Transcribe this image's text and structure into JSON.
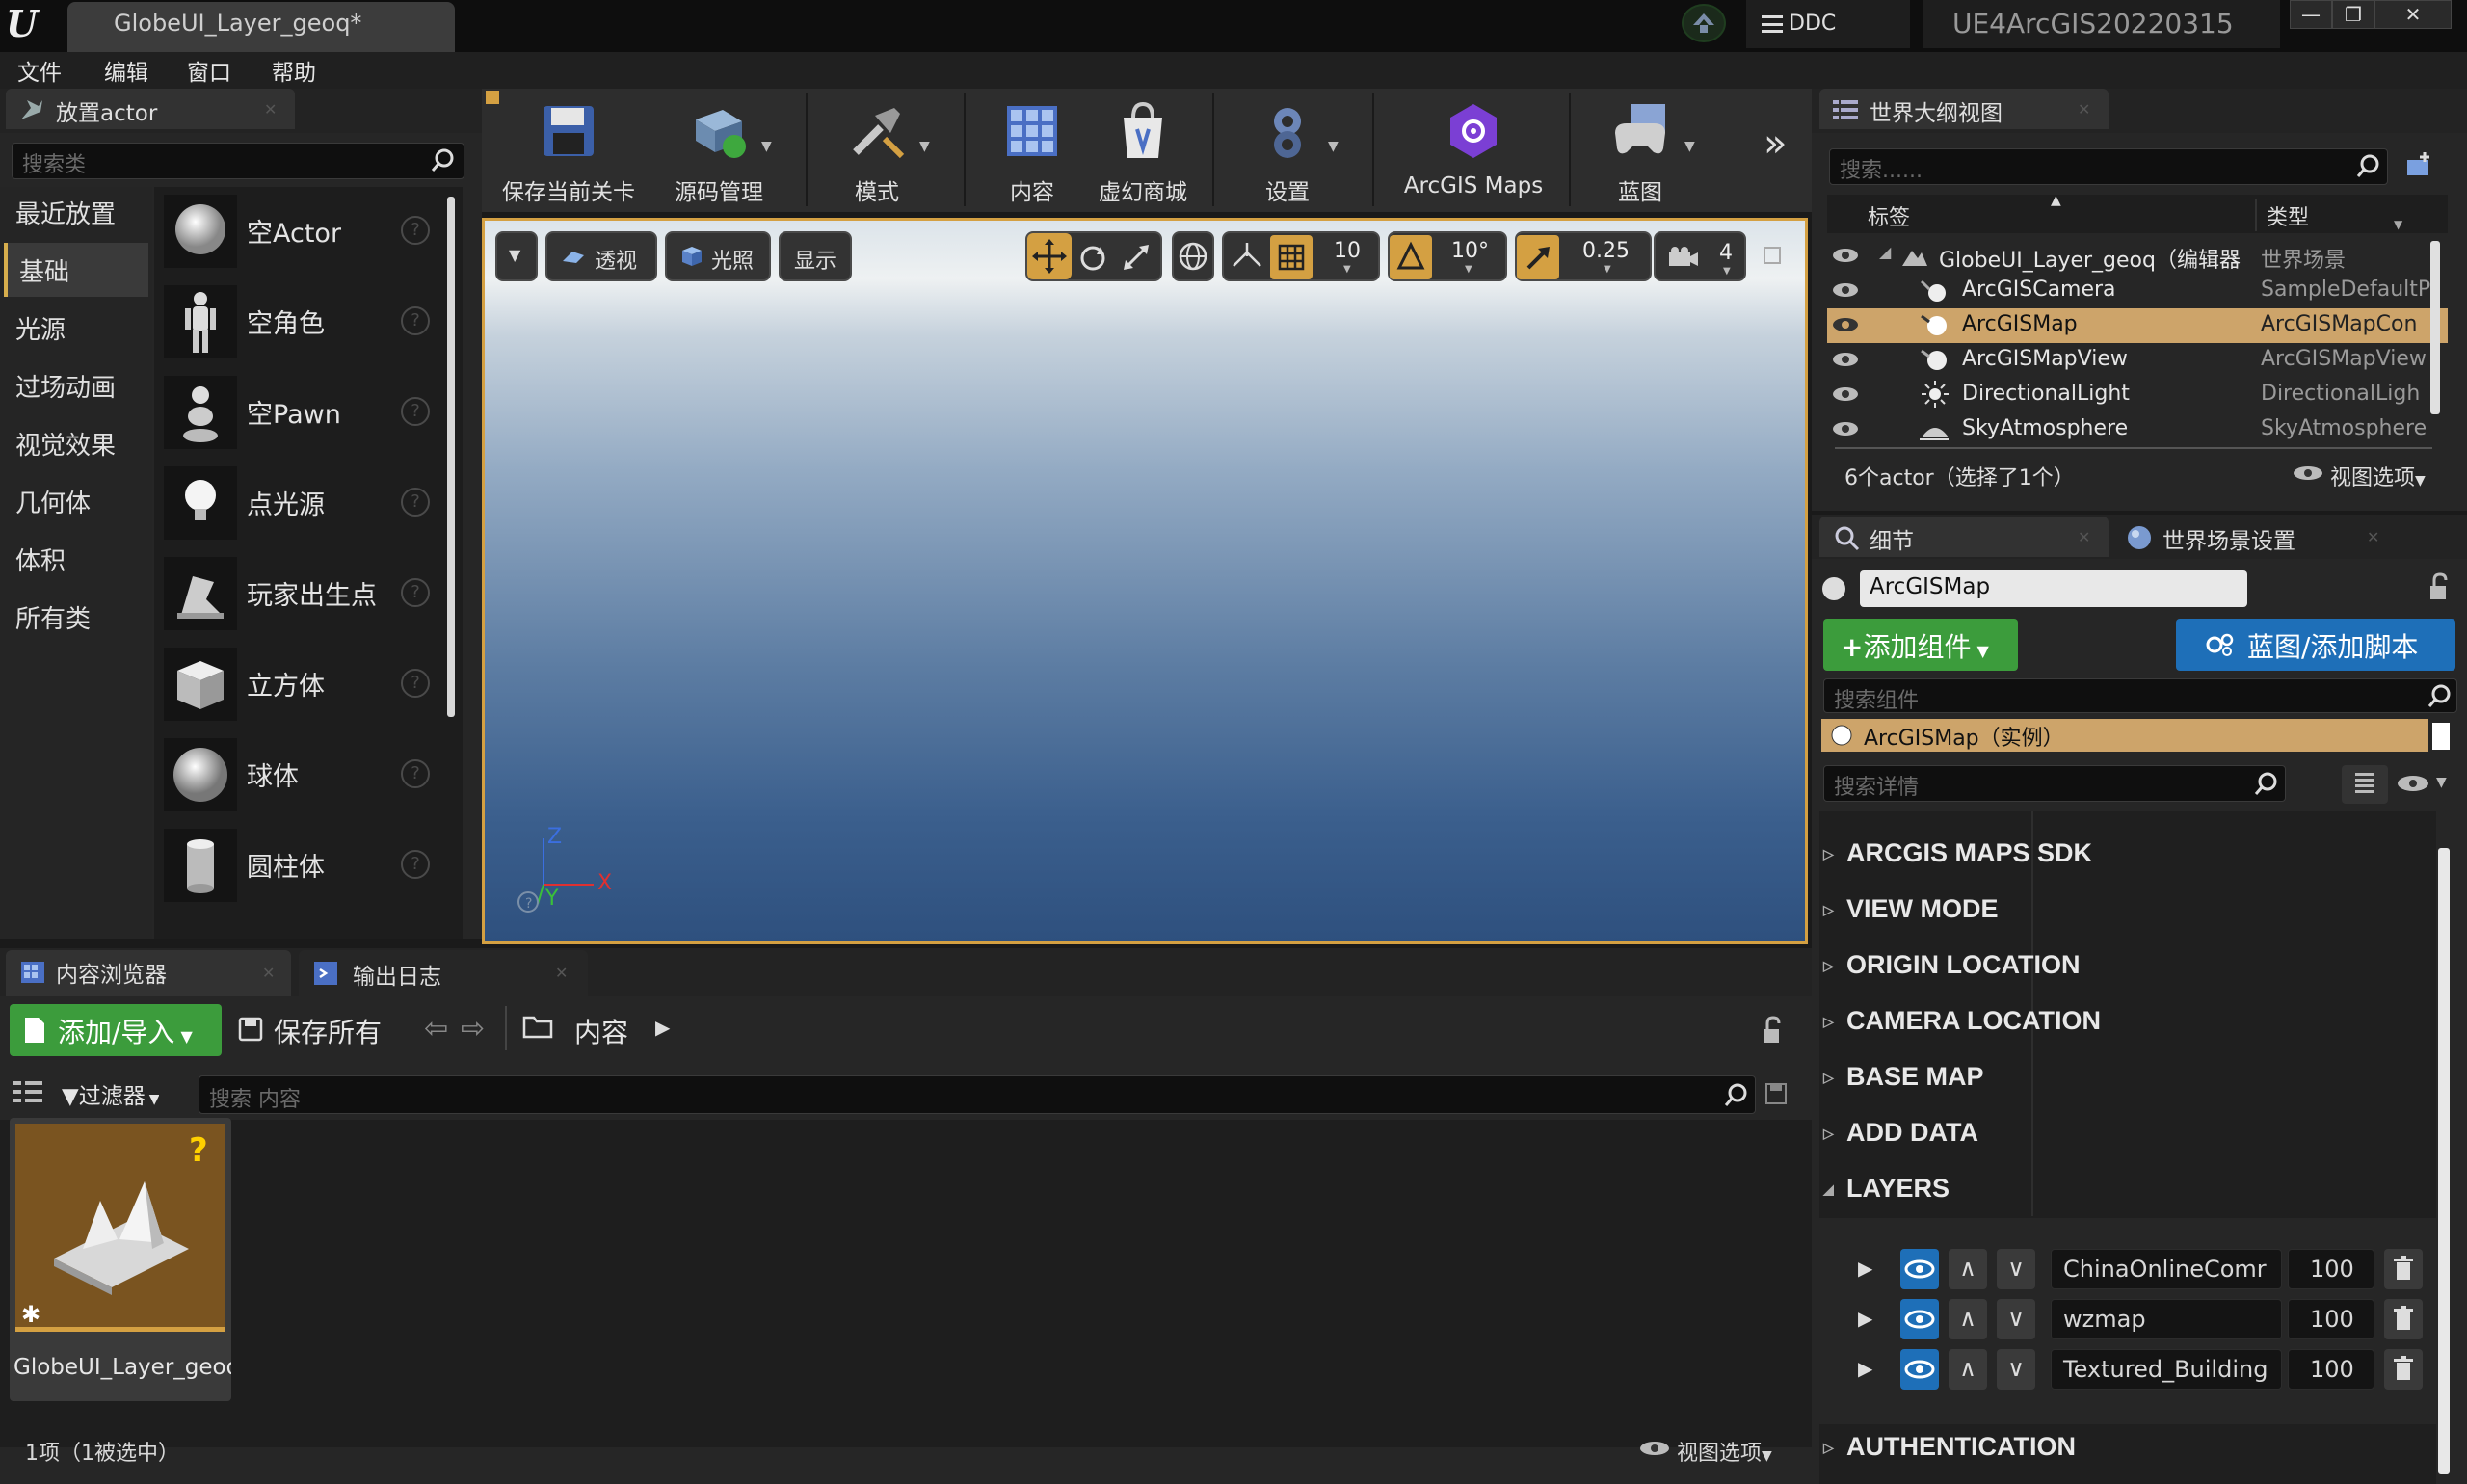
{
  "window": {
    "tab_title": "GlobeUI_Layer_geoq*",
    "ddc_label": "DDC",
    "project_name": "UE4ArcGIS20220315",
    "minimize": "—",
    "maximize": "❐",
    "close": "✕"
  },
  "menu": {
    "items": [
      "文件",
      "编辑",
      "窗口",
      "帮助"
    ]
  },
  "place_actors": {
    "tab_label": "放置actor",
    "search_placeholder": "搜索类",
    "categories": [
      "最近放置",
      "基础",
      "光源",
      "过场动画",
      "视觉效果",
      "几何体",
      "体积",
      "所有类"
    ],
    "selected_category": "基础",
    "items": [
      "空Actor",
      "空角色",
      "空Pawn",
      "点光源",
      "玩家出生点",
      "立方体",
      "球体",
      "圆柱体"
    ]
  },
  "toolbar": {
    "buttons": [
      "保存当前关卡",
      "源码管理",
      "模式",
      "内容",
      "虚幻商城",
      "设置",
      "ArcGIS Maps",
      "蓝图"
    ],
    "more": "»"
  },
  "viewport": {
    "perspective": "透视",
    "lighting": "光照",
    "show": "显示",
    "grid_snap": "10",
    "rotation_snap": "10°",
    "scale_snap": "0.25",
    "camera_speed": "4",
    "axis_z": "Z",
    "axis_x": "X",
    "axis_y": "Y"
  },
  "outliner": {
    "tab_label": "世界大纲视图",
    "search_placeholder": "搜索......",
    "col_label": "标签",
    "col_type": "类型",
    "rows": [
      {
        "name": "GlobeUI_Layer_geoq（编辑器",
        "type": "世界场景"
      },
      {
        "name": "ArcGISCamera",
        "type": "SampleDefaultP"
      },
      {
        "name": "ArcGISMap",
        "type": "ArcGISMapCon"
      },
      {
        "name": "ArcGISMapView",
        "type": "ArcGISMapView"
      },
      {
        "name": "DirectionalLight",
        "type": "DirectionalLigh"
      },
      {
        "name": "SkyAtmosphere",
        "type": "SkyAtmosphere"
      }
    ],
    "selected_row": "ArcGISMap",
    "status": "6个actor（选择了1个）",
    "view_options": "视图选项"
  },
  "details": {
    "tab_details": "细节",
    "tab_world_settings": "世界场景设置",
    "actor_name": "ArcGISMap",
    "add_component": "添加组件",
    "blueprint_script": "蓝图/添加脚本",
    "search_components_placeholder": "搜索组件",
    "component_instance": "ArcGISMap（实例）",
    "search_details_placeholder": "搜索详情",
    "sections": [
      "ARCGIS MAPS SDK",
      "VIEW MODE",
      "ORIGIN LOCATION",
      "CAMERA LOCATION",
      "BASE MAP",
      "ADD DATA",
      "LAYERS"
    ],
    "layers": [
      {
        "name": "ChinaOnlineComr",
        "opacity": "100"
      },
      {
        "name": "wzmap",
        "opacity": "100"
      },
      {
        "name": "Textured_Building",
        "opacity": "100"
      }
    ],
    "last_section": "AUTHENTICATION"
  },
  "content_browser": {
    "tab_label": "内容浏览器",
    "log_tab_label": "输出日志",
    "add_import": "添加/导入",
    "save_all": "保存所有",
    "path_root": "内容",
    "filters": "过滤器",
    "search_placeholder": "搜索 内容",
    "asset_name": "GlobeUI_Layer_geoq",
    "asset_badge": "?",
    "status": "1项（1被选中）",
    "view_options": "视图选项"
  },
  "colors": {
    "accent_orange": "#d4a042",
    "add_green": "#3c9c3c",
    "blueprint_blue": "#1e6fb8",
    "selection_tan": "#cda46a"
  }
}
